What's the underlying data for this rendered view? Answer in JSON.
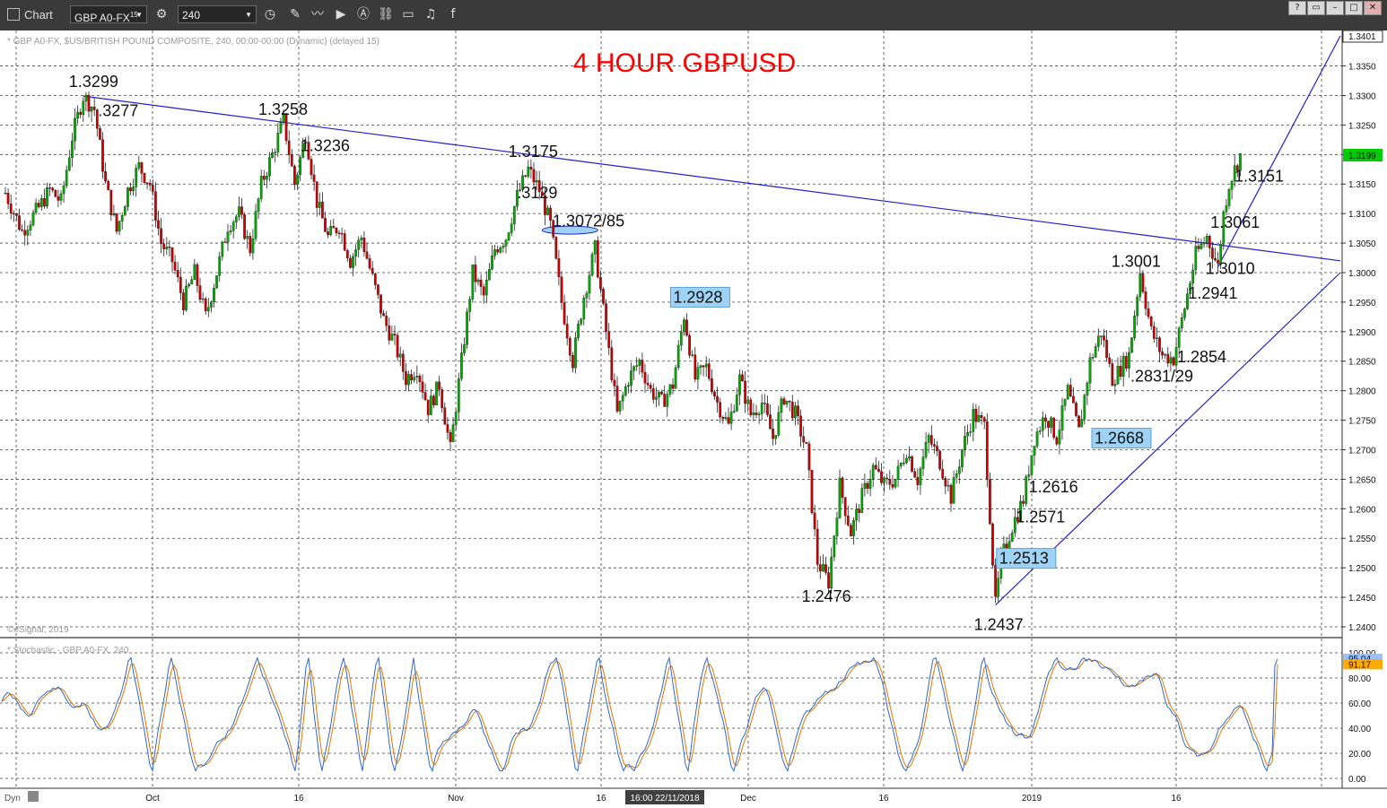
{
  "toolbar": {
    "title": "Chart",
    "symbol": "GBP A0-FX",
    "symbol_superscript": "15",
    "interval": "240"
  },
  "chart_info": "* GBP A0-FX, $US/BRITISH POUND COMPOSITE, 240, 00:00-00:00 (Dynamic) (delayed 15)",
  "stoch_info": "* Stochastic - GBP A0-FX, 240",
  "copyright": "©eSignal, 2019",
  "dyn_label": "Dyn",
  "cursor_time": "16:00 22/11/2018",
  "colors": {
    "up": "#00aa00",
    "down": "#cc0000",
    "trend": "#2222cc",
    "stoch_k": "#3366cc",
    "stoch_d": "#dd7700",
    "title": "#ff0000",
    "box": "#9fd3f5",
    "price_tag": "#00cc00",
    "stoch_tag": "#ffaa00"
  },
  "chart_data": {
    "type": "line",
    "title": "4 HOUR GBPUSD",
    "y_axis": {
      "min": 1.24,
      "max": 1.3401,
      "ticks": [
        "1.3350",
        "1.3300",
        "1.3250",
        "1.3200",
        "1.3150",
        "1.3100",
        "1.3050",
        "1.3000",
        "1.2950",
        "1.2900",
        "1.2850",
        "1.2800",
        "1.2750",
        "1.2700",
        "1.2650",
        "1.2600",
        "1.2550",
        "1.2500",
        "1.2450",
        "1.2400"
      ]
    },
    "x_axis": {
      "ticks": [
        "Oct",
        "16",
        "Nov",
        "16",
        "Dec",
        "16",
        "2019",
        "16"
      ]
    },
    "top_label": "1.3401",
    "current_price": "1.3199",
    "price_path": [
      [
        0,
        1.3135
      ],
      [
        3,
        1.307
      ],
      [
        6,
        1.311
      ],
      [
        8,
        1.314
      ],
      [
        10,
        1.312
      ],
      [
        12,
        1.323
      ],
      [
        14,
        1.3299
      ],
      [
        16,
        1.3277
      ],
      [
        18,
        1.315
      ],
      [
        20,
        1.307
      ],
      [
        22,
        1.314
      ],
      [
        24,
        1.318
      ],
      [
        26,
        1.315
      ],
      [
        28,
        1.305
      ],
      [
        30,
        1.302
      ],
      [
        32,
        1.295
      ],
      [
        34,
        1.3
      ],
      [
        36,
        1.2925
      ],
      [
        38,
        1.3
      ],
      [
        40,
        1.308
      ],
      [
        42,
        1.31
      ],
      [
        44,
        1.304
      ],
      [
        46,
        1.315
      ],
      [
        48,
        1.32
      ],
      [
        50,
        1.3258
      ],
      [
        52,
        1.315
      ],
      [
        54,
        1.3236
      ],
      [
        56,
        1.312
      ],
      [
        58,
        1.306
      ],
      [
        60,
        1.308
      ],
      [
        62,
        1.302
      ],
      [
        64,
        1.306
      ],
      [
        66,
        1.299
      ],
      [
        68,
        1.292
      ],
      [
        70,
        1.288
      ],
      [
        72,
        1.282
      ],
      [
        74,
        1.284
      ],
      [
        76,
        1.277
      ],
      [
        78,
        1.281
      ],
      [
        80,
        1.27
      ],
      [
        82,
        1.285
      ],
      [
        84,
        1.3
      ],
      [
        86,
        1.296
      ],
      [
        88,
        1.304
      ],
      [
        90,
        1.306
      ],
      [
        92,
        1.3129
      ],
      [
        94,
        1.3175
      ],
      [
        96,
        1.314
      ],
      [
        98,
        1.308
      ],
      [
        100,
        1.295
      ],
      [
        102,
        1.285
      ],
      [
        104,
        1.296
      ],
      [
        106,
        1.304
      ],
      [
        108,
        1.29
      ],
      [
        110,
        1.276
      ],
      [
        112,
        1.282
      ],
      [
        114,
        1.285
      ],
      [
        116,
        1.28
      ],
      [
        118,
        1.278
      ],
      [
        120,
        1.281
      ],
      [
        122,
        1.2928
      ],
      [
        124,
        1.282
      ],
      [
        126,
        1.284
      ],
      [
        128,
        1.278
      ],
      [
        130,
        1.274
      ],
      [
        132,
        1.282
      ],
      [
        134,
        1.276
      ],
      [
        136,
        1.278
      ],
      [
        138,
        1.272
      ],
      [
        140,
        1.279
      ],
      [
        142,
        1.276
      ],
      [
        144,
        1.27
      ],
      [
        146,
        1.251
      ],
      [
        148,
        1.2476
      ],
      [
        150,
        1.264
      ],
      [
        152,
        1.256
      ],
      [
        154,
        1.262
      ],
      [
        156,
        1.267
      ],
      [
        158,
        1.264
      ],
      [
        160,
        1.265
      ],
      [
        162,
        1.27
      ],
      [
        164,
        1.265
      ],
      [
        166,
        1.272
      ],
      [
        168,
        1.268
      ],
      [
        170,
        1.262
      ],
      [
        172,
        1.27
      ],
      [
        174,
        1.276
      ],
      [
        176,
        1.274
      ],
      [
        178,
        1.2437
      ],
      [
        179,
        1.2513
      ],
      [
        181,
        1.2571
      ],
      [
        183,
        1.2616
      ],
      [
        185,
        1.272
      ],
      [
        187,
        1.276
      ],
      [
        189,
        1.272
      ],
      [
        191,
        1.28
      ],
      [
        193,
        1.273
      ],
      [
        195,
        1.285
      ],
      [
        197,
        1.29
      ],
      [
        199,
        1.282
      ],
      [
        200,
        1.2831
      ],
      [
        202,
        1.286
      ],
      [
        204,
        1.3001
      ],
      [
        206,
        1.29
      ],
      [
        208,
        1.286
      ],
      [
        210,
        1.2854
      ],
      [
        212,
        1.2941
      ],
      [
        214,
        1.303
      ],
      [
        216,
        1.3061
      ],
      [
        218,
        1.301
      ],
      [
        219,
        1.31
      ],
      [
        220,
        1.3151
      ],
      [
        222,
        1.3199
      ]
    ],
    "levels": [
      {
        "label": "1.3299",
        "t": 14,
        "p": 1.3299
      },
      {
        "label": ".3277",
        "t": 16,
        "p": 1.3277
      },
      {
        "label": "1.3258",
        "t": 50,
        "p": 1.3258
      },
      {
        "label": "1.3236",
        "t": 54,
        "p": 1.3236
      },
      {
        "label": "1.3175",
        "t": 94,
        "p": 1.3175
      },
      {
        "label": ".3129",
        "t": 92,
        "p": 1.3129
      },
      {
        "label": "1.3072/85",
        "t": 100,
        "p": 1.3072
      },
      {
        "label": "1.2928",
        "t": 122,
        "p": 1.2928,
        "boxed": true
      },
      {
        "label": "1.2476",
        "t": 148,
        "p": 1.2476
      },
      {
        "label": "1.2437",
        "t": 178,
        "p": 1.2437
      },
      {
        "label": "1.2513",
        "t": 179,
        "p": 1.2513,
        "boxed": true
      },
      {
        "label": "1.2571",
        "t": 181,
        "p": 1.2571
      },
      {
        "label": "1.2616",
        "t": 183,
        "p": 1.2616
      },
      {
        "label": "1.2668",
        "t": 200,
        "p": 1.2668,
        "boxed": true
      },
      {
        "label": ".2831/29",
        "t": 200,
        "p": 1.2831
      },
      {
        "label": "1.3001",
        "t": 204,
        "p": 1.3001
      },
      {
        "label": "1.2854",
        "t": 210,
        "p": 1.2854
      },
      {
        "label": "1.2941",
        "t": 212,
        "p": 1.2941
      },
      {
        "label": "1.3010",
        "t": 218,
        "p": 1.301
      },
      {
        "label": "1.3061",
        "t": 216,
        "p": 1.3061
      },
      {
        "label": "1.3151",
        "t": 220,
        "p": 1.3151
      }
    ],
    "trendlines": [
      {
        "name": "downtrend",
        "from": [
          14,
          1.3299
        ],
        "to": [
          240,
          1.302
        ]
      },
      {
        "name": "uptrend-1",
        "from": [
          178,
          1.2437
        ],
        "to": [
          240,
          1.3
        ]
      },
      {
        "name": "uptrend-2",
        "from": [
          218,
          1.301
        ],
        "to": [
          240,
          1.3401
        ]
      }
    ],
    "stochastic": {
      "y_axis": {
        "min": 0,
        "max": 100,
        "ticks": [
          "100.00",
          "80.00",
          "60.00",
          "40.00",
          "20.00",
          "0.00"
        ]
      },
      "k_value": "95.04",
      "d_value": "91.17"
    }
  }
}
